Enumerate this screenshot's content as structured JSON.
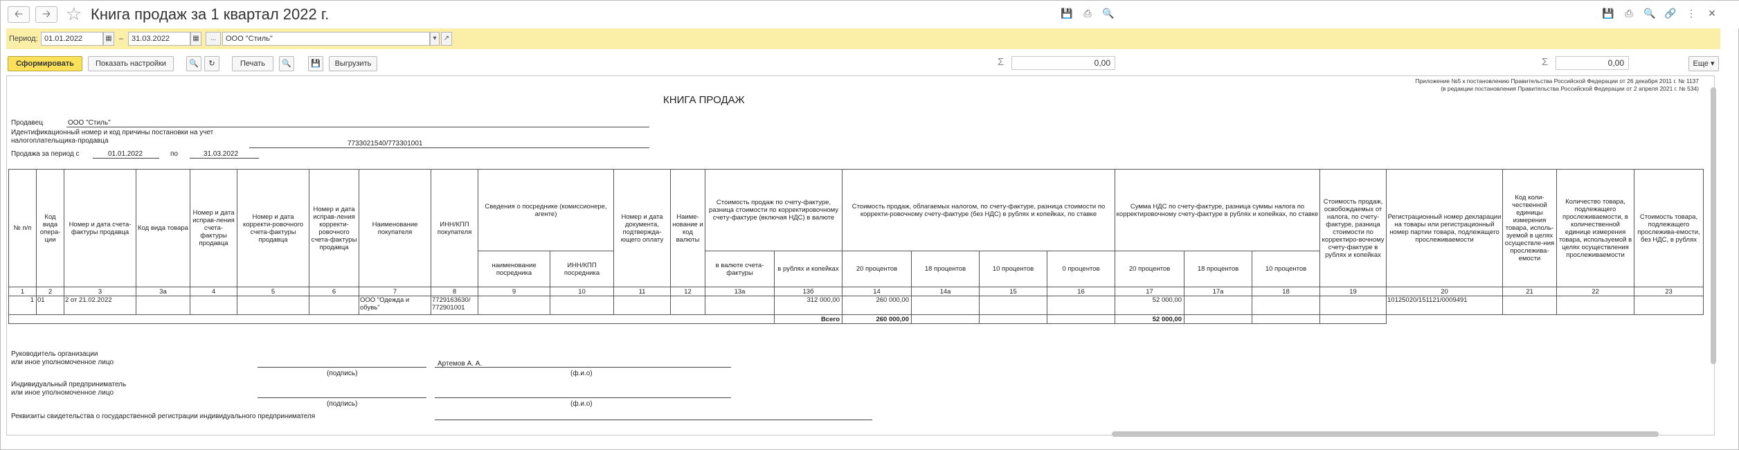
{
  "window": {
    "title": "Книга продаж за 1 квартал 2022 г."
  },
  "filter": {
    "period_label": "Период:",
    "date_from": "01.01.2022",
    "dash": "–",
    "date_to": "31.03.2022",
    "ellipsis": "...",
    "organization": "ООО \"Стиль\""
  },
  "toolbar": {
    "generate": "Сформировать",
    "show_settings": "Показать настройки",
    "print": "Печать",
    "export": "Выгрузить",
    "sum1": "0,00",
    "sum2": "0,00",
    "more": "Еще",
    "sigma": "Σ"
  },
  "report": {
    "appendix_line1": "Приложение №5 к постановлению Правительства Российской Федерации от 26 декабря 2011 г. № 1137",
    "appendix_line2": "(в редакции постановления Правительства Российской Федерации от 2 апреля 2021 г. № 534)",
    "heading": "КНИГА ПРОДАЖ",
    "seller_label": "Продавец",
    "seller_value": "ООО \"Стиль\"",
    "inn_label_1": "Идентификационный номер и код причины постановки на учет",
    "inn_label_2": "налогоплательщика-продавца",
    "inn_value": "7733021540/773301001",
    "period_label": "Продажа за период с",
    "period_from": "01.01.2022",
    "period_to_label": "по",
    "period_to": "31.03.2022",
    "headers": {
      "h1": "№ п/п",
      "h2": "Код вида опера-ции",
      "h3": "Номер и дата счета-фактуры продавца",
      "h3a": "Код вида товара",
      "h4": "Номер и дата исправ-ления счета-фактуры продавца",
      "h5": "Номер и дата корректи-ровочного счета-фактуры продавца",
      "h6": "Номер и дата исправ-ления корректи-ровочного счета-фактуры продавца",
      "h7": "Наименование покупателя",
      "h8": "ИНН/КПП покупателя",
      "h_agent": "Сведения о посреднике (комиссионере, агенте)",
      "h9": "наименование посредника",
      "h10": "ИНН/КПП посредника",
      "h11": "Номер и дата документа, подтвержда-ющего оплату",
      "h12": "Наиме-нование и код валюты",
      "h13": "Стоимость продаж по счету-фактуре, разница стоимости по корректировочному счету-фактуре (включая НДС) в валюте",
      "h13a": "в валюте счета-фактуры",
      "h13b": "в рублях и копейках",
      "h_taxed": "Стоимость продаж, облагаемых налогом, по счету-фактуре, разница стоимости по корректи-ровочному счету-фактуре (без НДС) в рублях и копейках, по ставке",
      "h14": "20 процентов",
      "h14a": "18 процентов",
      "h15": "10 процентов",
      "h16": "0 процентов",
      "h_vat": "Сумма НДС по счету-фактуре, разница суммы налога по корректировочному счету-фактуре в рублях и копейках, по ставке",
      "h17": "20 процентов",
      "h17a": "18 процентов",
      "h18": "10 процентов",
      "h19": "Стоимость продаж, освобождаемых от налога, по счету-фактуре, разница стоимости по корректиро-вочному счету-фактуре в рублях и копейках",
      "h20": "Регистрационный номер декларации на товары или регистрационный номер партии товара, подлежащего прослеживаемости",
      "h21": "Код коли-чественной единицы измерения товара, исполь-зуемой в целях осуществле-ния прослежива-емости",
      "h22": "Количество товара, подлежащего прослеживаемости, в количественной единице измерения товара, используемой в целях осуществления прослеживаемости",
      "h23": "Стоимость товара, подлежащего прослежива-емости, без НДС, в рублях"
    },
    "col_numbers": [
      "1",
      "2",
      "3",
      "3а",
      "4",
      "5",
      "6",
      "7",
      "8",
      "9",
      "10",
      "11",
      "12",
      "13а",
      "13б",
      "14",
      "14а",
      "15",
      "16",
      "17",
      "17а",
      "18",
      "19",
      "20",
      "21",
      "22",
      "23"
    ],
    "row": {
      "n": "1",
      "op": "01",
      "invoice": "2 от 21.02.2022",
      "buyer": "ООО \"Одежда и обувь\"",
      "buyer_inn": "7729163630/ 772901001",
      "sum_rub": "312 000,00",
      "taxed20": "260 000,00",
      "vat20": "52 000,00",
      "reg_num": "10125020/151121/0009491"
    },
    "total_label": "Всего",
    "total_taxed20": "260 000,00",
    "total_vat20": "52 000,00",
    "sign_head_1": "Руководитель организации",
    "sign_head_2": "или иное уполномоченное лицо",
    "signature_caption": "(подпись)",
    "fio_caption": "(ф.и.о)",
    "head_name": "Артемов А. А.",
    "sign_ip_1": "Индивидуальный предприниматель",
    "sign_ip_2": "или иное уполномоченное лицо",
    "ip_reg_label": "Реквизиты свидетельства о государственной регистрации индивидуального предпринимателя"
  }
}
